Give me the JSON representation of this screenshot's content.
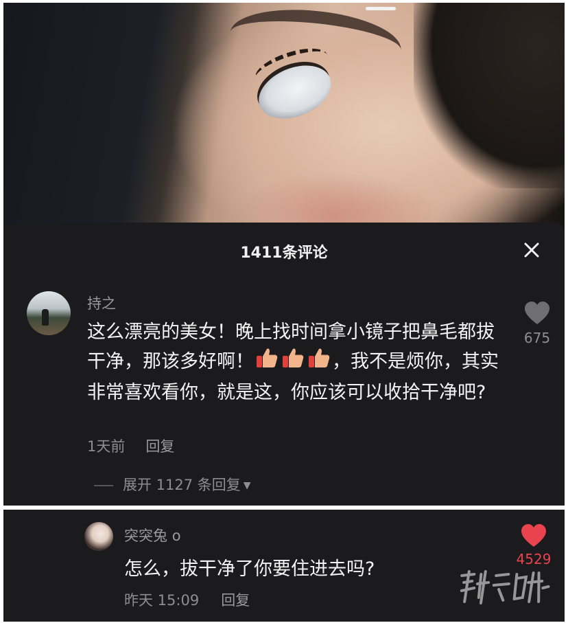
{
  "colors": {
    "panel_bg": "#1b1b1d",
    "text_primary": "#f4f4f4",
    "text_secondary": "#8e8e92",
    "like_active": "#e8434f",
    "like_inactive": "#6f6f73"
  },
  "header": {
    "title": "1411条评论",
    "close_icon": "close-icon"
  },
  "comments": [
    {
      "username": "持之",
      "text_part1": "这么漂亮的美女！晚上找时间拿小镜子把鼻毛都拔干净，那该多好啊！",
      "emoji_icon": "thumbs-up-icon",
      "emoji_count": 3,
      "text_part2": "，我不是烦你，其实非常喜欢看你，就是这，你应该可以收拾干净吧?",
      "time": "1天前",
      "reply_label": "回复",
      "likes": "675",
      "liked": false,
      "expand_label": "展开 1127 条回复"
    }
  ],
  "reply": {
    "username": "突突兔",
    "badge": "o",
    "text": "怎么，拔干净了你要住进去吗?",
    "time": "昨天 15:09",
    "reply_label": "回复",
    "likes": "4529",
    "liked": true
  },
  "watermark": "搜事百科"
}
